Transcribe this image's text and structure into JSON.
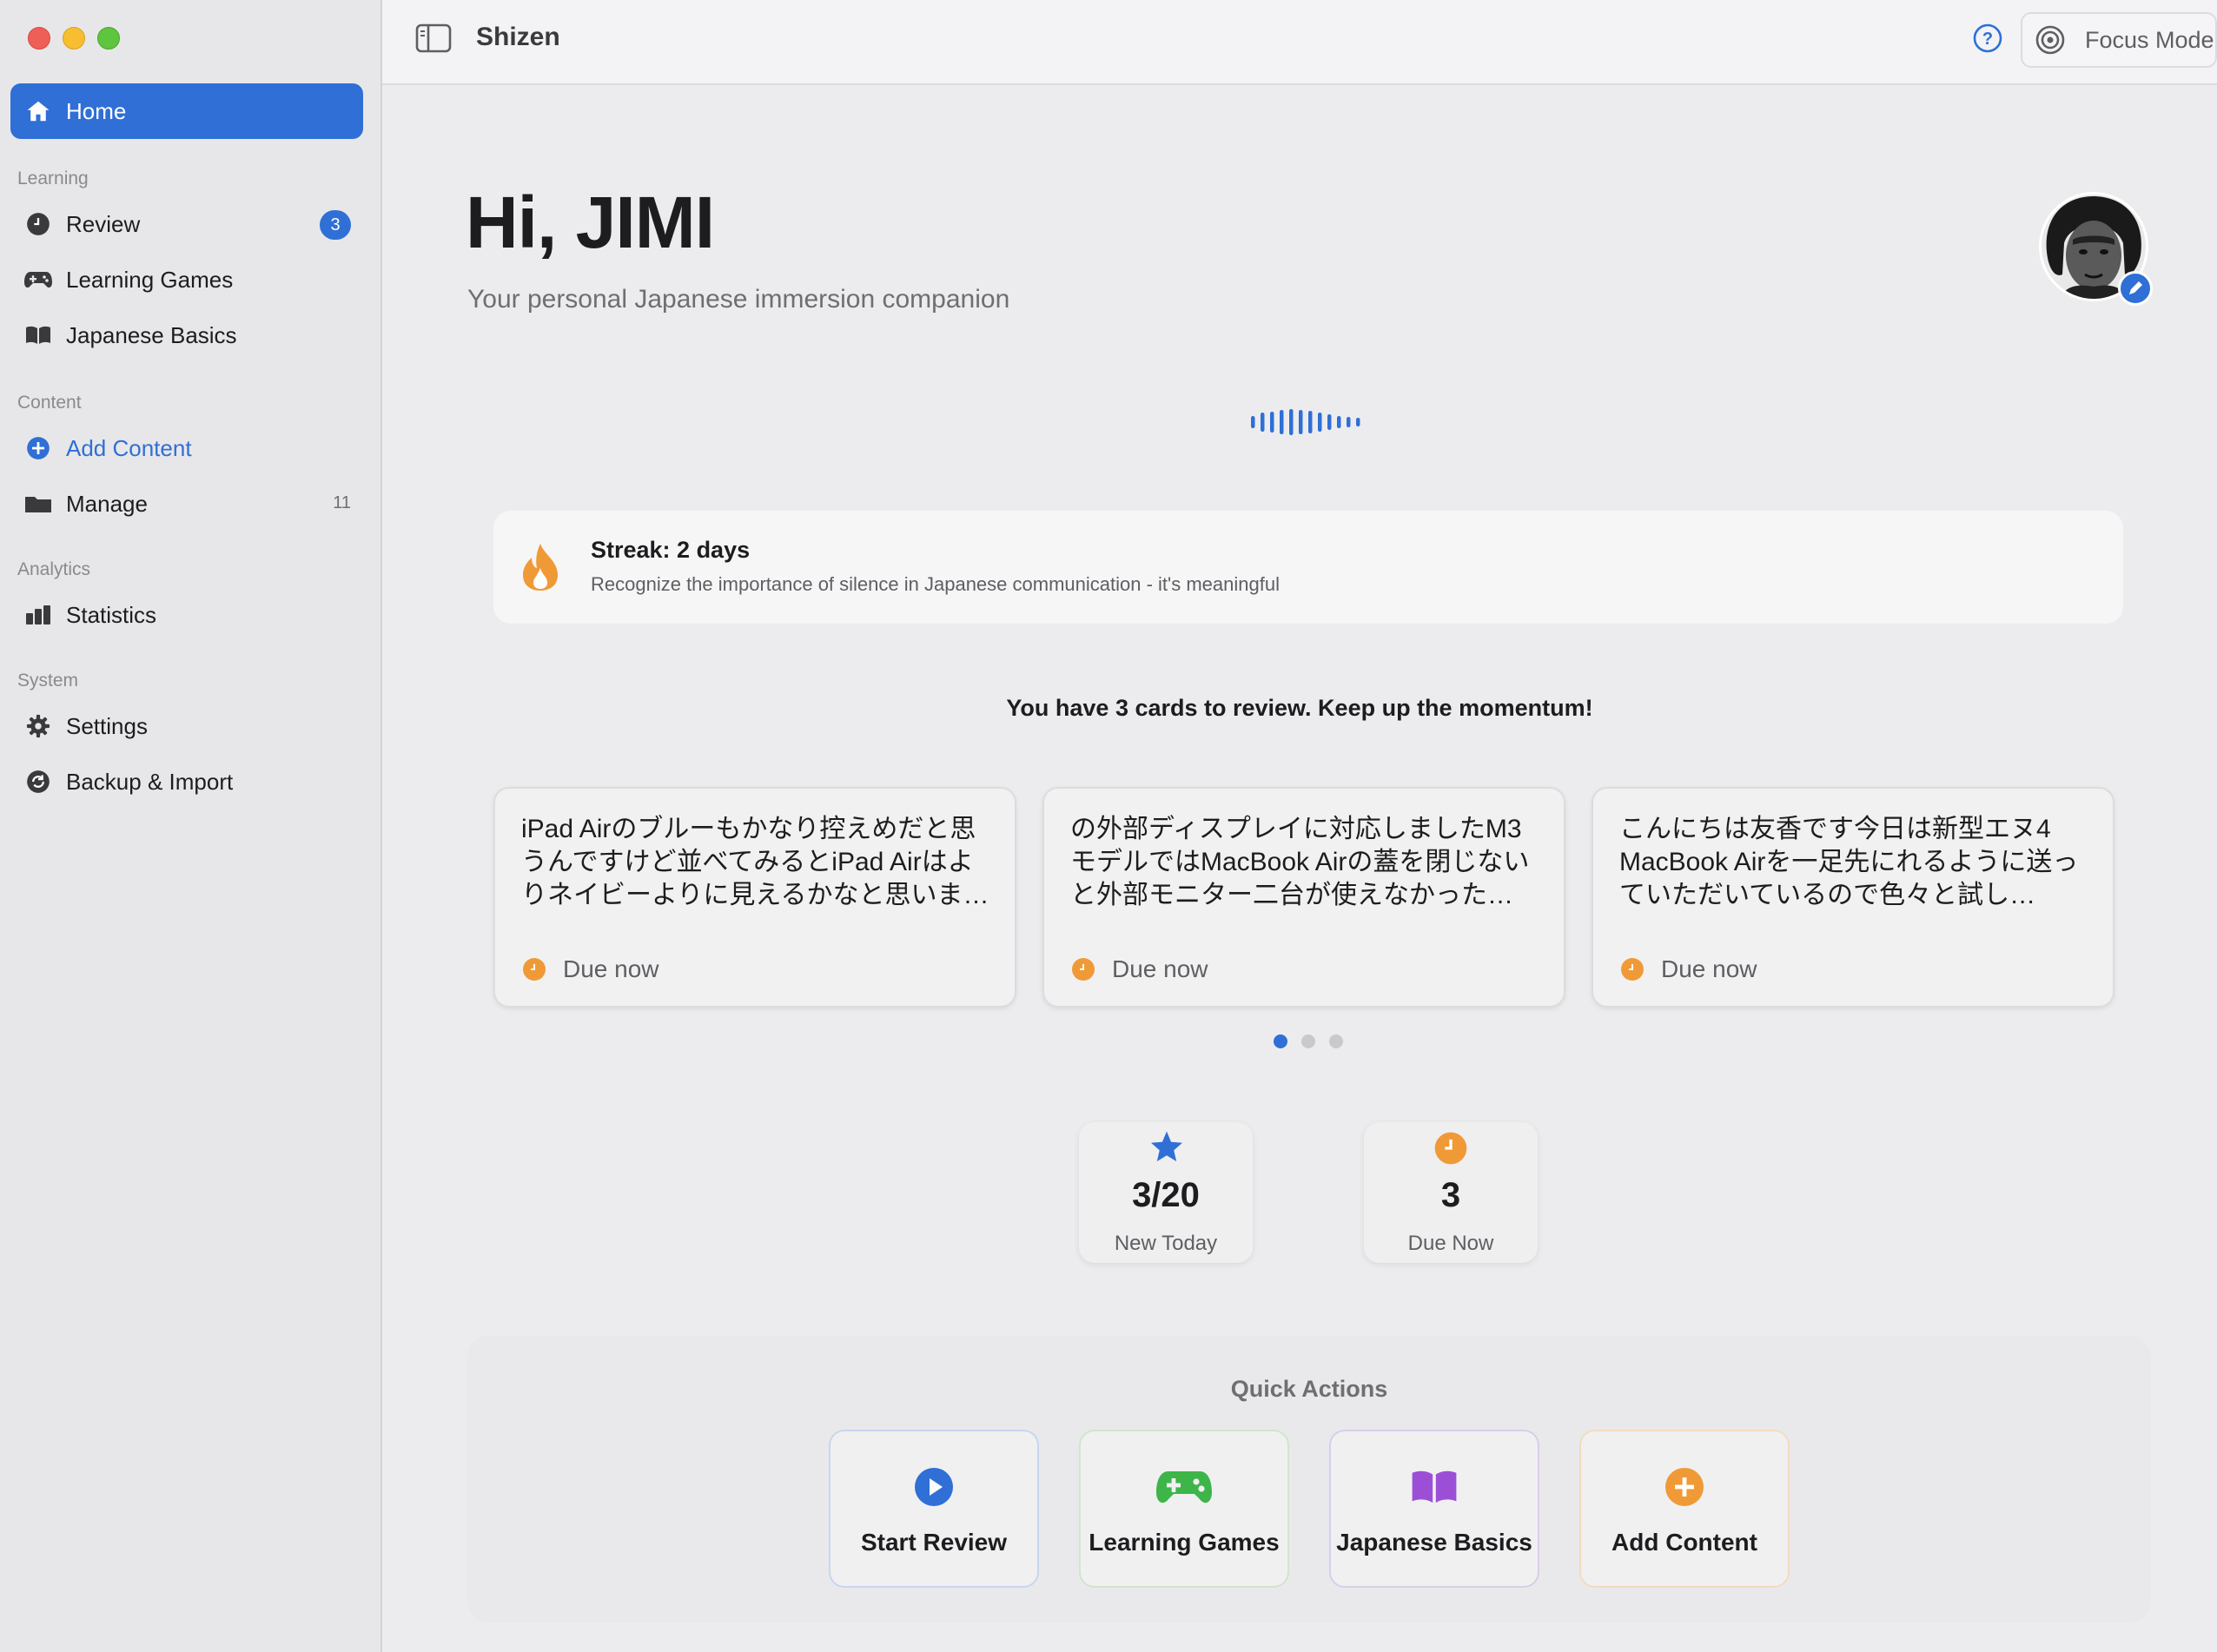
{
  "app": {
    "title": "Shizen"
  },
  "toolbar": {
    "focus_mode_label": "Focus Mode"
  },
  "sidebar": {
    "home_label": "Home",
    "sections": {
      "learning": "Learning",
      "content": "Content",
      "analytics": "Analytics",
      "system": "System"
    },
    "items": {
      "review": {
        "label": "Review",
        "badge": "3"
      },
      "learning_games": {
        "label": "Learning Games"
      },
      "japanese_basics": {
        "label": "Japanese Basics"
      },
      "add_content": {
        "label": "Add Content"
      },
      "manage": {
        "label": "Manage",
        "count": "11"
      },
      "statistics": {
        "label": "Statistics"
      },
      "settings": {
        "label": "Settings"
      },
      "backup_import": {
        "label": "Backup & Import"
      }
    }
  },
  "greeting": {
    "title": "Hi, JIMI",
    "subtitle": "Your personal Japanese immersion companion"
  },
  "streak": {
    "title": "Streak: 2 days",
    "tip": "Recognize the importance of silence in Japanese communication - it's meaningful"
  },
  "review_message": "You have 3 cards to review. Keep up the momentum!",
  "cards": [
    {
      "text": "iPad Airのブルーもかなり控えめだと思うんですけど並べてみるとiPad Airはよりネイビーよりに見えるかなと思いま…",
      "due": "Due now"
    },
    {
      "text": "の外部ディスプレイに対応しましたM3モデルではMacBook Airの蓋を閉じないと外部モニター二台が使えなかった…",
      "due": "Due now"
    },
    {
      "text": "こんにちは友香です今日は新型エヌ4 MacBook Airを一足先にれるように送っていただいているので色々と試し…",
      "due": "Due now"
    }
  ],
  "pagination": {
    "total": 3,
    "active": 0
  },
  "stats": {
    "new_today": {
      "value": "3/20",
      "label": "New Today"
    },
    "due_now": {
      "value": "3",
      "label": "Due Now"
    }
  },
  "quick_actions": {
    "title": "Quick Actions",
    "start_review": "Start Review",
    "learning_games": "Learning Games",
    "japanese_basics": "Japanese Basics",
    "add_content": "Add Content"
  },
  "colors": {
    "accent": "#2f6fd6",
    "orange": "#f09a37",
    "green": "#3db549",
    "purple": "#9b4fd6"
  }
}
